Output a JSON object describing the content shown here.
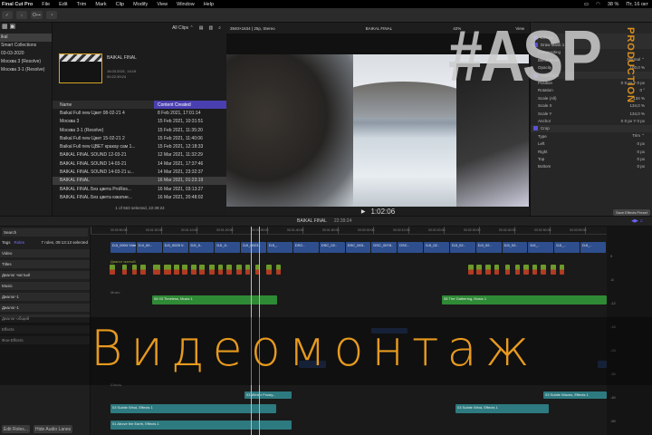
{
  "menubar": {
    "app": "Final Cut Pro",
    "items": [
      "File",
      "Edit",
      "Trim",
      "Mark",
      "Clip",
      "Modify",
      "View",
      "Window",
      "Help"
    ],
    "battery": "38 %",
    "clock": "Пт, 16  окт"
  },
  "toolbar": {
    "keywords_btn": "O⊶"
  },
  "libraries": {
    "items": [
      "ikal",
      "Smart Collections",
      "03-03-2020",
      "Москва 3 (Resolve)",
      "Москва 3-1 (Resolve)"
    ]
  },
  "browser": {
    "filter": "All Clips ⌃",
    "project": {
      "name": "BAIKAL FINAL",
      "date": "16.03.2021, 14:19",
      "duration": "00:22:39:24"
    },
    "columns": {
      "name": "Name",
      "date": "Content Created"
    },
    "rows": [
      {
        "name": "Baikal Full new Цвет 08-02-21 4",
        "date": "8 Feb 2021, 17:01:14"
      },
      {
        "name": "Москва 3",
        "date": "15 Feb 2021, 10:31:51"
      },
      {
        "name": "Москва 3-1 (Resolve)",
        "date": "15 Feb 2021, 11:35:20"
      },
      {
        "name": "Baikal Full new Цвет 15-02-21 2",
        "date": "15 Feb 2021, 11:40:06"
      },
      {
        "name": "Baikal Full new ЦВЕТ кракау сам 1...",
        "date": "15 Feb 2021, 12:18:33"
      },
      {
        "name": "BAIKAL FINAL SOUND 12-03-21",
        "date": "12 Mar 2021, 11:32:29"
      },
      {
        "name": "BAIKAL FINAL SOUND 14-03-21",
        "date": "14 Mar 2021, 17:37:46"
      },
      {
        "name": "BAIKAL FINAL SOUND 14-03-21 u...",
        "date": "14 Mar 2021, 23:32:37"
      },
      {
        "name": "BAIKAL FINAL",
        "date": "16 Mar 2021, 01:23:19"
      },
      {
        "name": "BAIKAL FINAL  Без цвета ProRes...",
        "date": "16 Mar 2021, 03:13:27"
      },
      {
        "name": "BAIKAL FINAL  Без цвета южатие...",
        "date": "16 Mar 2021, 20:48:02"
      }
    ],
    "footer": "1 of 563 selected, 22:39:24"
  },
  "viewer": {
    "format": "3840×1634 | 25p, Stereo",
    "title": "BAIKAL FINAL",
    "zoom": "42%",
    "view": "View",
    "timecode": "1:02:06"
  },
  "inspector": {
    "rows": [
      {
        "label": "Effects",
        "value": "",
        "sec": true
      },
      {
        "label": "Draw Mask 1",
        "value": "",
        "sec": true
      },
      {
        "label": "Compositing",
        "value": ""
      },
      {
        "label": "Blend Mode",
        "value": "Normal ⌃"
      },
      {
        "label": "Opacity",
        "value": "100,0 %"
      },
      {
        "label": "Transform",
        "value": "",
        "sec": true
      },
      {
        "label": "Position",
        "value": "X  0 px   Y  0 px"
      },
      {
        "label": "Rotation",
        "value": "0 °"
      },
      {
        "label": "Scale (All)",
        "value": "134 %"
      },
      {
        "label": "Scale X",
        "value": "134,0 %"
      },
      {
        "label": "Scale Y",
        "value": "134,0 %"
      },
      {
        "label": "Anchor",
        "value": "X  0 px   Y  0 px"
      },
      {
        "label": "Crop",
        "value": "",
        "sec": true
      },
      {
        "label": "Type",
        "value": "Trim ⌃"
      },
      {
        "label": "Left",
        "value": "0 px"
      },
      {
        "label": "Right",
        "value": "0 px"
      },
      {
        "label": "Top",
        "value": "0 px"
      },
      {
        "label": "Bottom",
        "value": "0 px"
      }
    ],
    "save_btn": "Save Effects Preset"
  },
  "timeline": {
    "project": "BAIKAL FINAL",
    "duration": "22:39:24",
    "ruler": [
      "00:00:50:00",
      "00:01:00:00",
      "00:01:10:00",
      "00:01:20:00",
      "00:01:30:00",
      "00:01:40:00",
      "00:01:50:00",
      "00:02:00:00",
      "00:02:10:00",
      "00:02:20:00",
      "00:02:30:00",
      "00:02:40:00",
      "00:02:50:00",
      "00:03:00:00"
    ],
    "primary_clips": [
      "DJI_0004 Video",
      "DJI_00..",
      "DJI_0025 V..",
      "DJI_0..",
      "DJI_0..",
      "DJI_0023..",
      "DJI_..",
      "DSC..",
      "DSC_02..",
      "DSC_003..",
      "DSC_0078..",
      "DSC..",
      "DJI_02..",
      "DJI_02..",
      "DJI_02..",
      "DJI_02..",
      "DJI_..",
      "DJI_..",
      "DJI_.."
    ],
    "lane_labels": [
      "Диалог чистый",
      "Music",
      "Effects"
    ],
    "music": [
      "06 03 Timeless, Music 1",
      "08 The Gathering, Music 1"
    ],
    "effects": [
      "03 Subtle Wind, Effects 1",
      "01 Above the Earth, Effects 1",
      "03 Subtle Wind, Effects 1",
      "03 Subtle Waves, Effects 1",
      "03 Winter Frosty..."
    ]
  },
  "index": {
    "search": "Search",
    "tabs": [
      "Tags",
      "Roles"
    ],
    "summary": "7 roles, 09:13:13 selected",
    "roles": [
      "Video",
      "Titles",
      "Диалог чистый",
      "Music",
      "Диалог-1",
      "Диалог-1",
      "Диалог-общий",
      "Effects",
      "Фон-Effects"
    ],
    "buttons": [
      "Edit Roles...",
      "Hide Audio Lanes"
    ]
  },
  "meters": {
    "labels": [
      "0",
      "-6",
      "-12",
      "-18",
      "-24",
      "-30",
      "-40",
      "-50"
    ]
  },
  "overlay": {
    "title": "Видеомонтаж",
    "logo": "#ASP",
    "logo_sub": "PRODUCTION"
  },
  "colors": {
    "accent": "#5b52d6",
    "overlay_text": "#e79a1f",
    "playhead": "#e7b829"
  }
}
